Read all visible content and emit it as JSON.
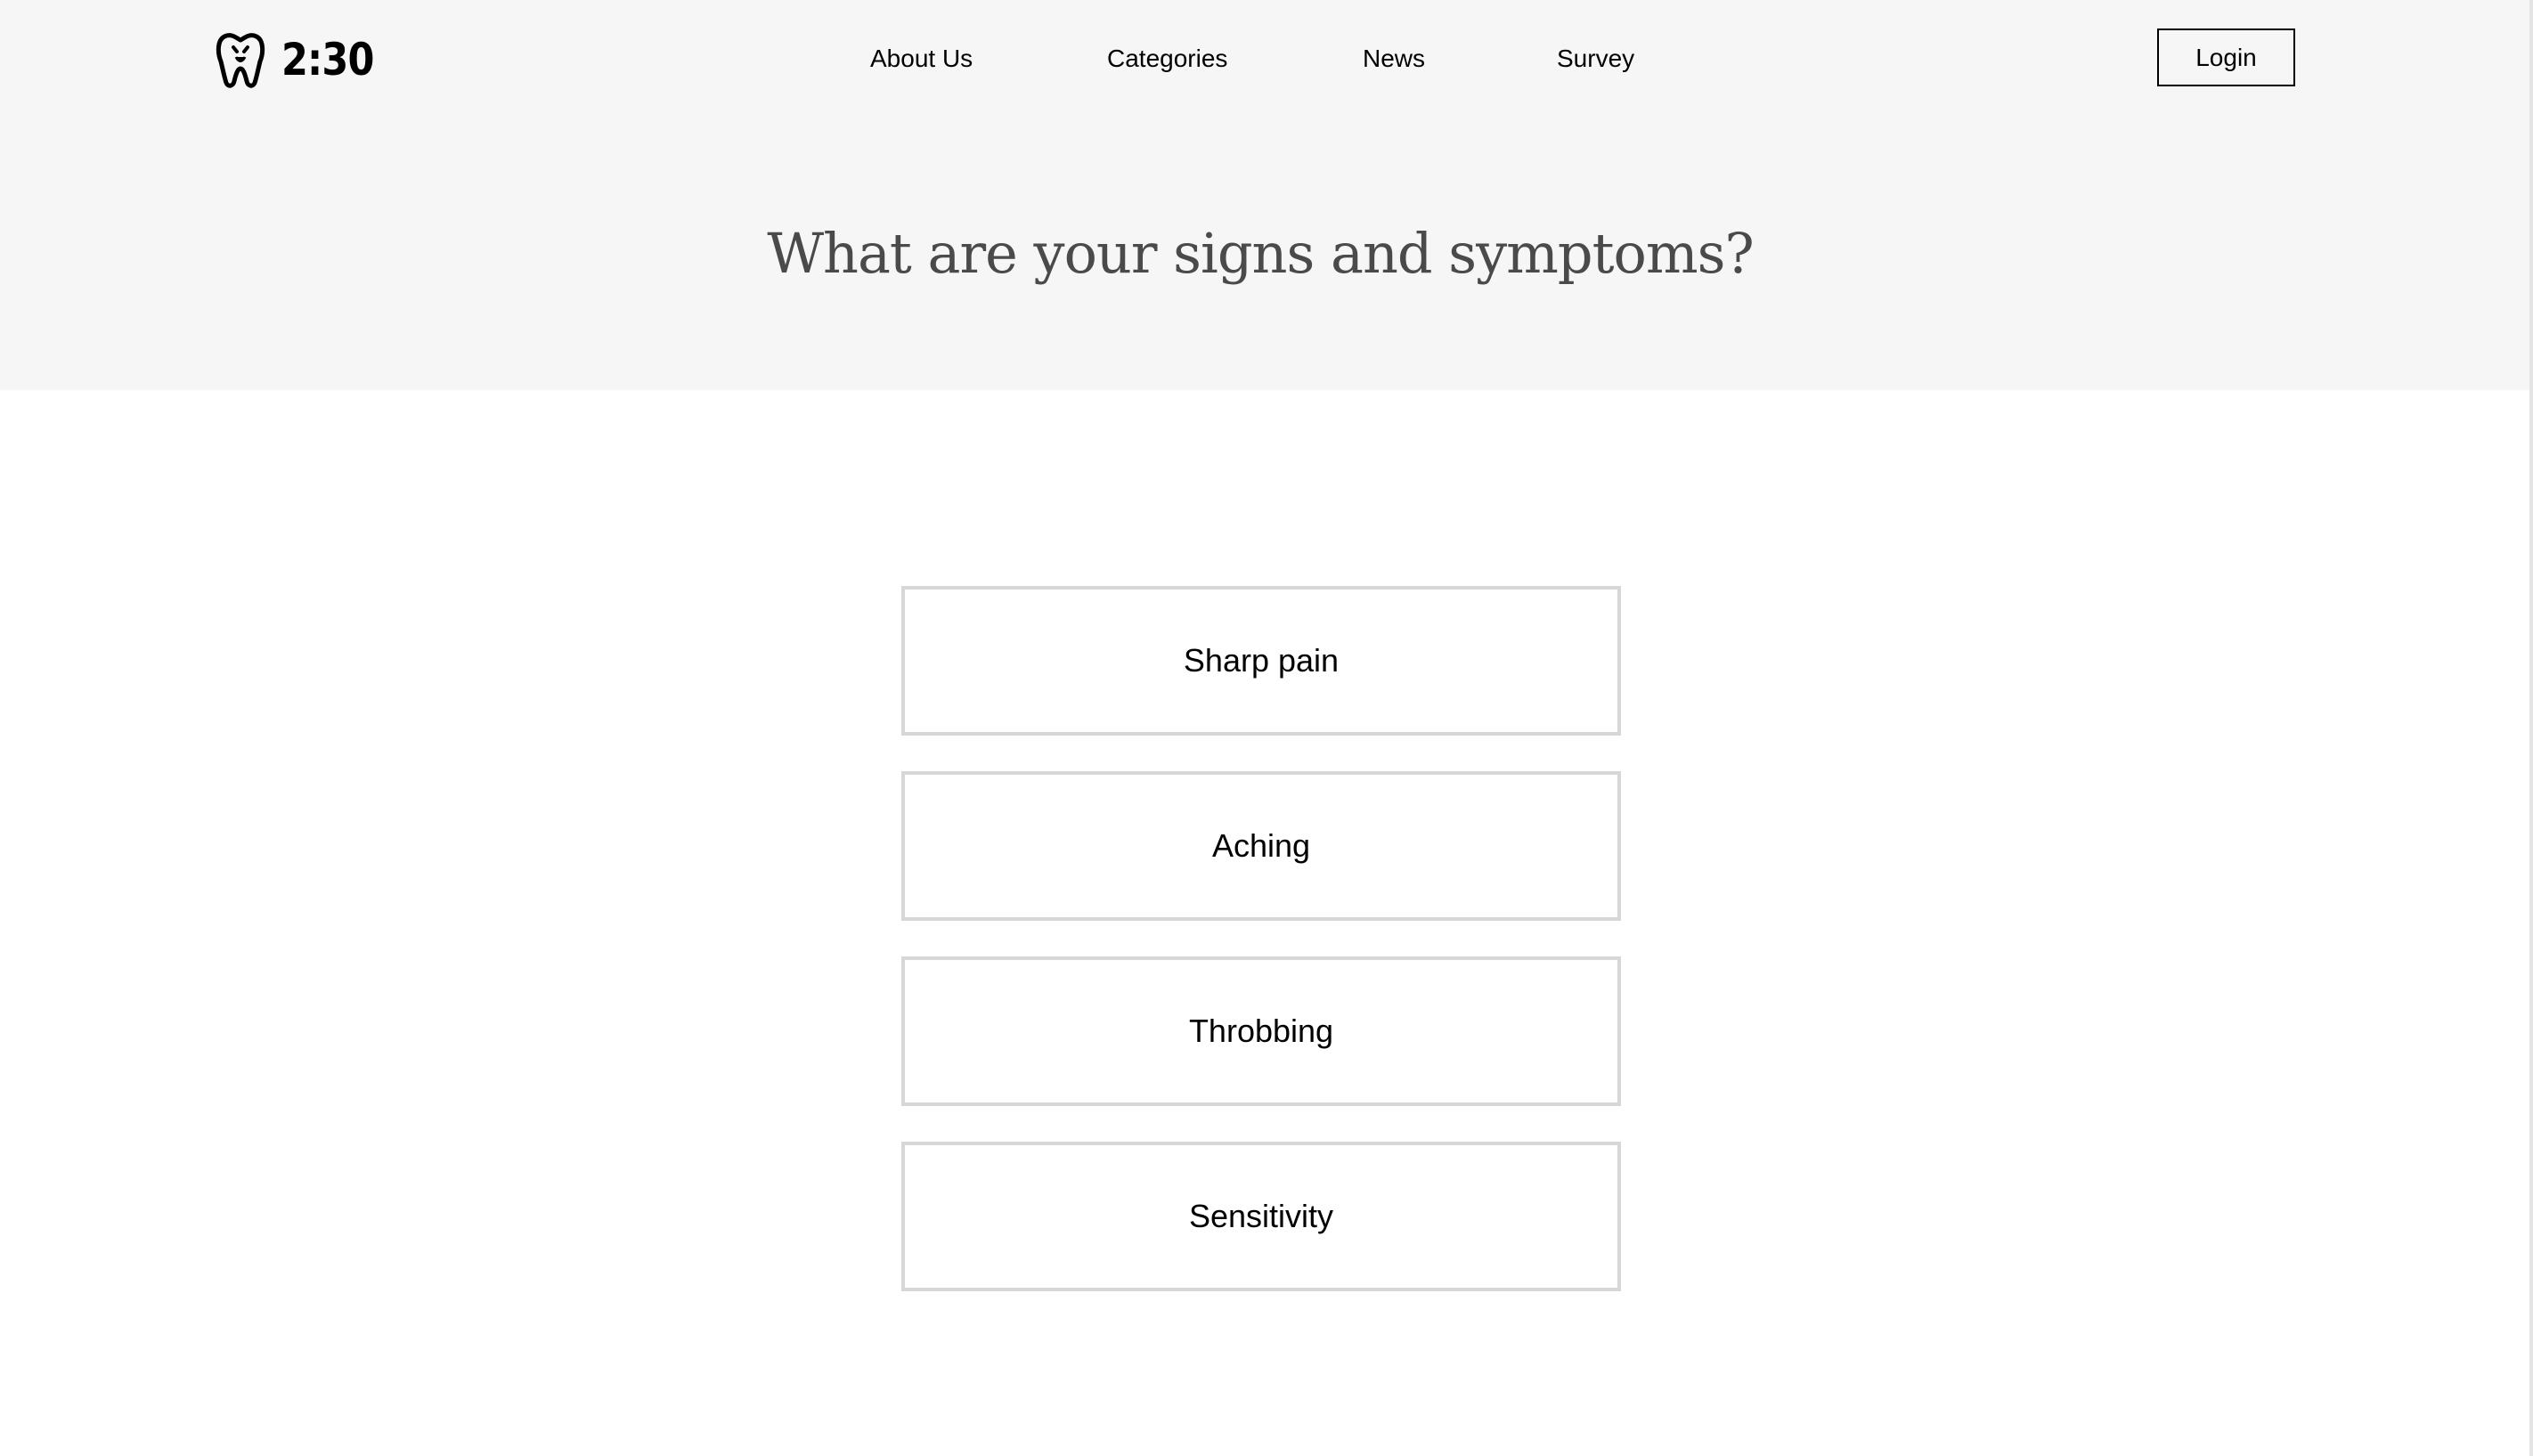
{
  "brand": {
    "name": "2:30",
    "logo_icon": "tooth-face-icon"
  },
  "nav": {
    "items": [
      {
        "label": "About Us"
      },
      {
        "label": "Categories"
      },
      {
        "label": "News"
      },
      {
        "label": "Survey"
      }
    ],
    "login_label": "Login"
  },
  "hero": {
    "title": "What are your signs and symptoms?"
  },
  "symptoms": {
    "options": [
      {
        "label": "Sharp pain"
      },
      {
        "label": "Aching"
      },
      {
        "label": "Throbbing"
      },
      {
        "label": "Sensitivity"
      }
    ]
  },
  "colors": {
    "hero_background": "#f6f6f6",
    "page_background": "#ffffff",
    "title_text": "#4a4a4a",
    "option_border": "#d7d7d7",
    "text": "#000000"
  }
}
